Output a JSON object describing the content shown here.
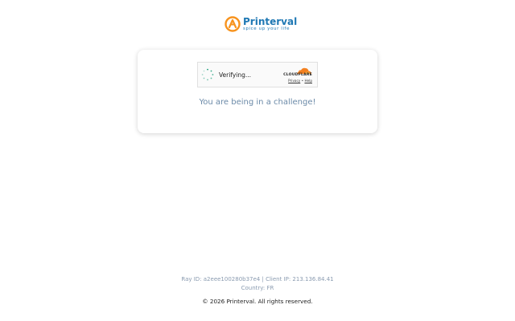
{
  "logo": {
    "name": "Printerval",
    "tagline": "spice up your life",
    "mark_icon": "printerval-logo-icon",
    "brand_color": "#1f78b4",
    "accent_color": "#f7931e"
  },
  "challenge": {
    "widget": {
      "status_text": "Verifying...",
      "spinner_icon": "spinner-icon",
      "provider_word": "CLOUDFLARE",
      "provider_icon": "cloudflare-logo-icon",
      "privacy_link": "Privacy",
      "separator": "•",
      "help_link": "Help"
    },
    "message": "You are being in a challenge!"
  },
  "footer": {
    "ray_line": "Ray ID: a2eee100280b37e4 | Client IP: 213.136.84.41",
    "country_line": "Country: FR",
    "copyright": "© 2026 Printerval. All rights reserved."
  }
}
